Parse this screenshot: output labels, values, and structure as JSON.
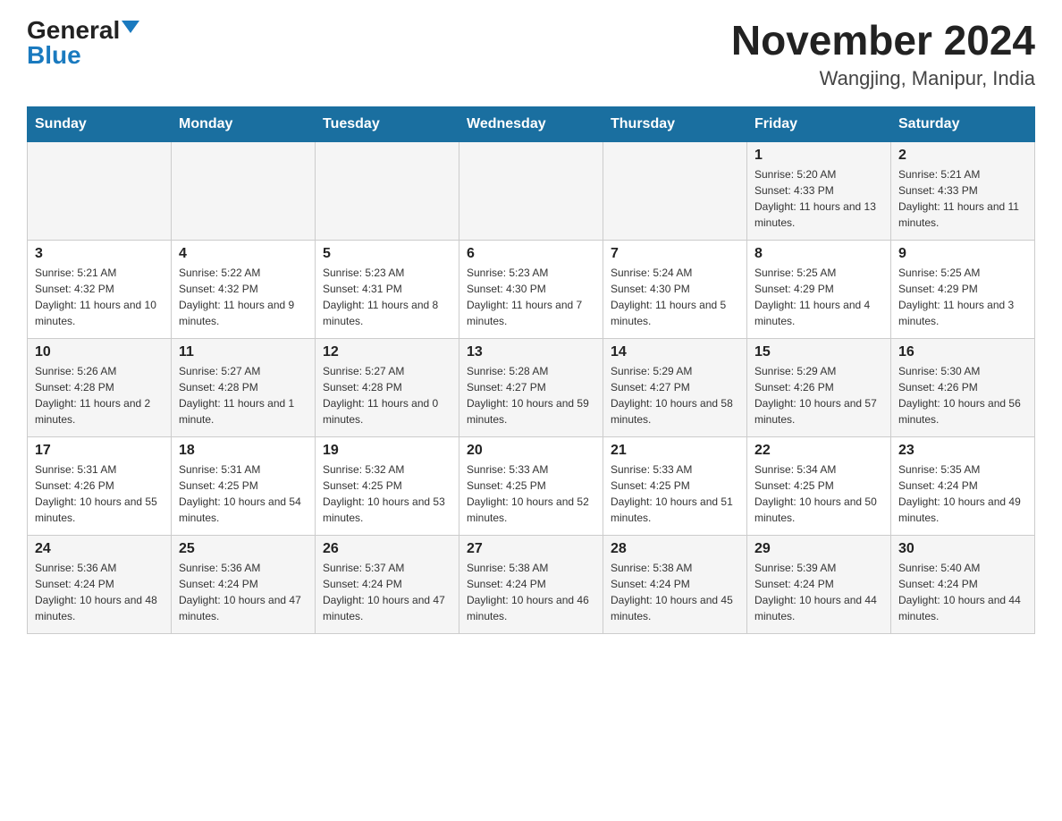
{
  "header": {
    "logo_general": "General",
    "logo_blue": "Blue",
    "month_title": "November 2024",
    "location": "Wangjing, Manipur, India"
  },
  "days_of_week": [
    "Sunday",
    "Monday",
    "Tuesday",
    "Wednesday",
    "Thursday",
    "Friday",
    "Saturday"
  ],
  "weeks": [
    {
      "days": [
        {
          "number": "",
          "info": ""
        },
        {
          "number": "",
          "info": ""
        },
        {
          "number": "",
          "info": ""
        },
        {
          "number": "",
          "info": ""
        },
        {
          "number": "",
          "info": ""
        },
        {
          "number": "1",
          "info": "Sunrise: 5:20 AM\nSunset: 4:33 PM\nDaylight: 11 hours and 13 minutes."
        },
        {
          "number": "2",
          "info": "Sunrise: 5:21 AM\nSunset: 4:33 PM\nDaylight: 11 hours and 11 minutes."
        }
      ]
    },
    {
      "days": [
        {
          "number": "3",
          "info": "Sunrise: 5:21 AM\nSunset: 4:32 PM\nDaylight: 11 hours and 10 minutes."
        },
        {
          "number": "4",
          "info": "Sunrise: 5:22 AM\nSunset: 4:32 PM\nDaylight: 11 hours and 9 minutes."
        },
        {
          "number": "5",
          "info": "Sunrise: 5:23 AM\nSunset: 4:31 PM\nDaylight: 11 hours and 8 minutes."
        },
        {
          "number": "6",
          "info": "Sunrise: 5:23 AM\nSunset: 4:30 PM\nDaylight: 11 hours and 7 minutes."
        },
        {
          "number": "7",
          "info": "Sunrise: 5:24 AM\nSunset: 4:30 PM\nDaylight: 11 hours and 5 minutes."
        },
        {
          "number": "8",
          "info": "Sunrise: 5:25 AM\nSunset: 4:29 PM\nDaylight: 11 hours and 4 minutes."
        },
        {
          "number": "9",
          "info": "Sunrise: 5:25 AM\nSunset: 4:29 PM\nDaylight: 11 hours and 3 minutes."
        }
      ]
    },
    {
      "days": [
        {
          "number": "10",
          "info": "Sunrise: 5:26 AM\nSunset: 4:28 PM\nDaylight: 11 hours and 2 minutes."
        },
        {
          "number": "11",
          "info": "Sunrise: 5:27 AM\nSunset: 4:28 PM\nDaylight: 11 hours and 1 minute."
        },
        {
          "number": "12",
          "info": "Sunrise: 5:27 AM\nSunset: 4:28 PM\nDaylight: 11 hours and 0 minutes."
        },
        {
          "number": "13",
          "info": "Sunrise: 5:28 AM\nSunset: 4:27 PM\nDaylight: 10 hours and 59 minutes."
        },
        {
          "number": "14",
          "info": "Sunrise: 5:29 AM\nSunset: 4:27 PM\nDaylight: 10 hours and 58 minutes."
        },
        {
          "number": "15",
          "info": "Sunrise: 5:29 AM\nSunset: 4:26 PM\nDaylight: 10 hours and 57 minutes."
        },
        {
          "number": "16",
          "info": "Sunrise: 5:30 AM\nSunset: 4:26 PM\nDaylight: 10 hours and 56 minutes."
        }
      ]
    },
    {
      "days": [
        {
          "number": "17",
          "info": "Sunrise: 5:31 AM\nSunset: 4:26 PM\nDaylight: 10 hours and 55 minutes."
        },
        {
          "number": "18",
          "info": "Sunrise: 5:31 AM\nSunset: 4:25 PM\nDaylight: 10 hours and 54 minutes."
        },
        {
          "number": "19",
          "info": "Sunrise: 5:32 AM\nSunset: 4:25 PM\nDaylight: 10 hours and 53 minutes."
        },
        {
          "number": "20",
          "info": "Sunrise: 5:33 AM\nSunset: 4:25 PM\nDaylight: 10 hours and 52 minutes."
        },
        {
          "number": "21",
          "info": "Sunrise: 5:33 AM\nSunset: 4:25 PM\nDaylight: 10 hours and 51 minutes."
        },
        {
          "number": "22",
          "info": "Sunrise: 5:34 AM\nSunset: 4:25 PM\nDaylight: 10 hours and 50 minutes."
        },
        {
          "number": "23",
          "info": "Sunrise: 5:35 AM\nSunset: 4:24 PM\nDaylight: 10 hours and 49 minutes."
        }
      ]
    },
    {
      "days": [
        {
          "number": "24",
          "info": "Sunrise: 5:36 AM\nSunset: 4:24 PM\nDaylight: 10 hours and 48 minutes."
        },
        {
          "number": "25",
          "info": "Sunrise: 5:36 AM\nSunset: 4:24 PM\nDaylight: 10 hours and 47 minutes."
        },
        {
          "number": "26",
          "info": "Sunrise: 5:37 AM\nSunset: 4:24 PM\nDaylight: 10 hours and 47 minutes."
        },
        {
          "number": "27",
          "info": "Sunrise: 5:38 AM\nSunset: 4:24 PM\nDaylight: 10 hours and 46 minutes."
        },
        {
          "number": "28",
          "info": "Sunrise: 5:38 AM\nSunset: 4:24 PM\nDaylight: 10 hours and 45 minutes."
        },
        {
          "number": "29",
          "info": "Sunrise: 5:39 AM\nSunset: 4:24 PM\nDaylight: 10 hours and 44 minutes."
        },
        {
          "number": "30",
          "info": "Sunrise: 5:40 AM\nSunset: 4:24 PM\nDaylight: 10 hours and 44 minutes."
        }
      ]
    }
  ]
}
